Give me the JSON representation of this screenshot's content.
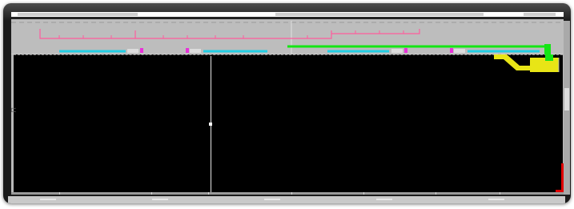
{
  "title": "",
  "colors": {
    "background": "#000000",
    "elevation": "#bdbdbd",
    "pink_line": "#ff5c9d",
    "cyan_line": "#22cde3",
    "magenta_tag": "#e832d9",
    "green_line": "#14e614",
    "yellow_duct": "#e8e516",
    "red_marker": "#e00000",
    "grid_line": "#e6e6e6"
  },
  "icons": {
    "left_handle": "bracket-handle-icon",
    "grid_node": "grid-node-icon"
  },
  "labels": {
    "left_handle_glyph": "⊏"
  }
}
